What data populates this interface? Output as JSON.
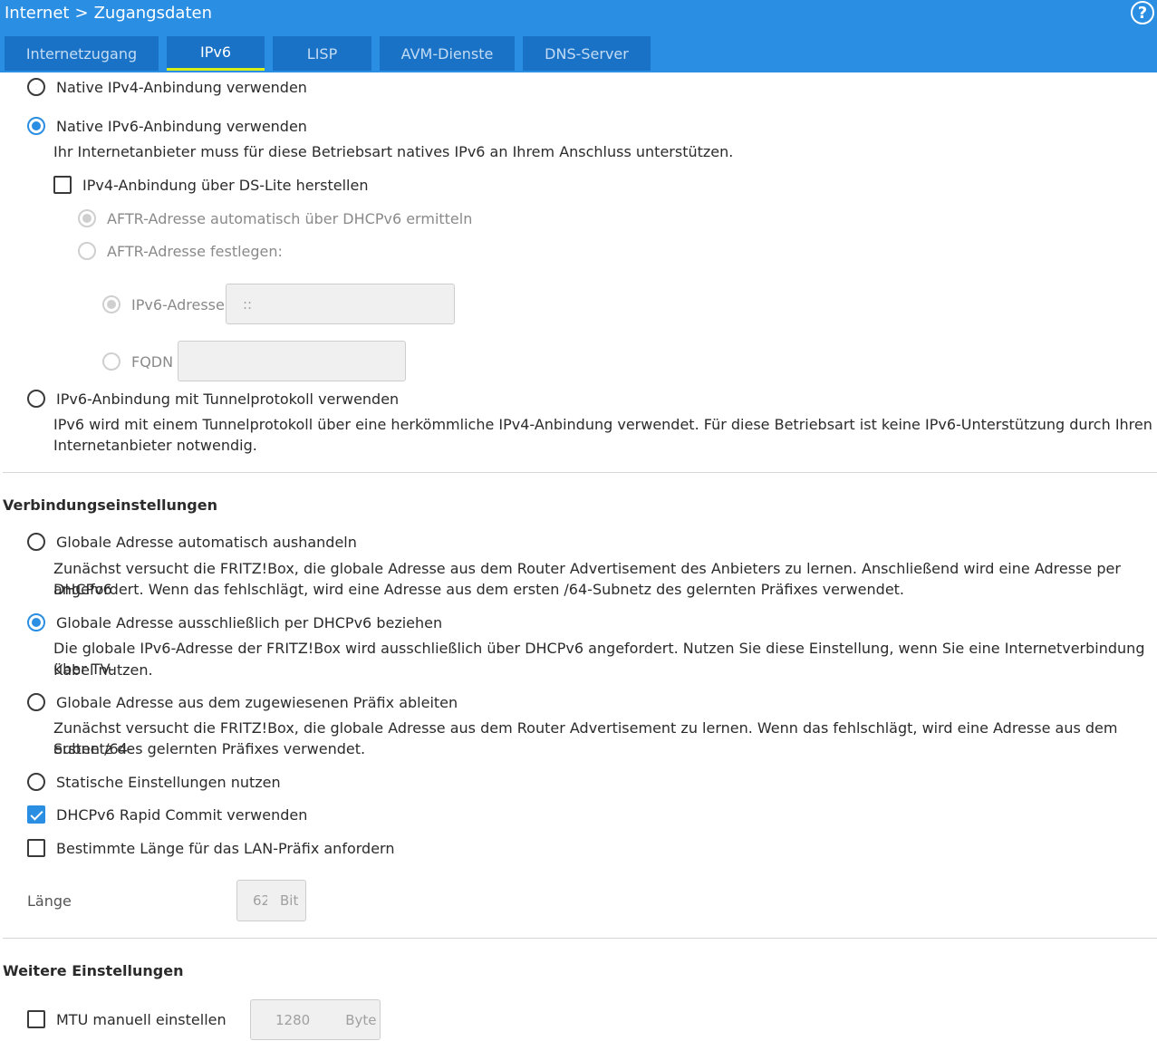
{
  "header": {
    "breadcrumb": [
      "Internet",
      "Zugangsdaten"
    ],
    "separator": ">",
    "help_icon": "?"
  },
  "tabs": [
    {
      "label": "Internetzugang",
      "active": false
    },
    {
      "label": "IPv6",
      "active": true
    },
    {
      "label": "LISP",
      "active": false
    },
    {
      "label": "AVM-Dienste",
      "active": false
    },
    {
      "label": "DNS-Server",
      "active": false
    }
  ],
  "connection_type": {
    "native_ipv4": "Native IPv4-Anbindung verwenden",
    "native_ipv6": "Native IPv6-Anbindung verwenden",
    "native_ipv6_desc": "Ihr Internetanbieter muss für diese Betriebsart natives IPv6 an Ihrem Anschluss unterstützen.",
    "ds_lite": "IPv4-Anbindung über DS-Lite herstellen",
    "aftr_auto": "AFTR-Adresse automatisch über DHCPv6 ermitteln",
    "aftr_manual": "AFTR-Adresse festlegen:",
    "ipv6_address_label": "IPv6-Adresse",
    "ipv6_address_value": "::",
    "fqdn_label": "FQDN",
    "fqdn_value": "",
    "tunnel": "IPv6-Anbindung mit Tunnelprotokoll verwenden",
    "tunnel_desc_1": "IPv6 wird mit einem Tunnelprotokoll über eine herkömmliche IPv4-Anbindung verwendet. Für diese Betriebsart ist keine IPv6-Unterstützung durch Ihren",
    "tunnel_desc_2": "Internetanbieter notwendig."
  },
  "connection_settings": {
    "title": "Verbindungseinstellungen",
    "auto": "Globale Adresse automatisch aushandeln",
    "auto_desc_1": "Zunächst versucht die FRITZ!Box, die globale Adresse aus dem Router Advertisement des Anbieters zu lernen. Anschließend wird eine Adresse per DHCPv6",
    "auto_desc_2": "angefordert. Wenn das fehlschlägt, wird eine Adresse aus dem ersten /64-Subnetz des gelernten Präfixes verwendet.",
    "dhcpv6_only": "Globale Adresse ausschließlich per DHCPv6 beziehen",
    "dhcpv6_only_desc_1": "Die globale IPv6-Adresse der FRITZ!Box wird ausschließlich über DHCPv6 angefordert. Nutzen Sie diese Einstellung, wenn Sie eine Internetverbindung über TV-",
    "dhcpv6_only_desc_2": "Kabel nutzen.",
    "from_prefix": "Globale Adresse aus dem zugewiesenen Präfix ableiten",
    "from_prefix_desc_1": "Zunächst versucht die FRITZ!Box, die globale Adresse aus dem Router Advertisement zu lernen. Wenn das fehlschlägt, wird eine Adresse aus dem ersten /64-",
    "from_prefix_desc_2": "Subnetz des gelernten Präfixes verwendet.",
    "static": "Statische Einstellungen nutzen",
    "rapid_commit": "DHCPv6 Rapid Commit verwenden",
    "prefix_length": "Bestimmte Länge für das LAN-Präfix anfordern",
    "length_label": "Länge",
    "length_value": "62",
    "length_unit": "Bit"
  },
  "further_settings": {
    "title": "Weitere Einstellungen",
    "mtu": "MTU manuell einstellen",
    "mtu_value": "1280",
    "mtu_unit": "Byte"
  },
  "colors": {
    "accent": "#2a8ee3",
    "tab_bg": "#1a72c7",
    "tab_active_underline": "#d8f015"
  }
}
